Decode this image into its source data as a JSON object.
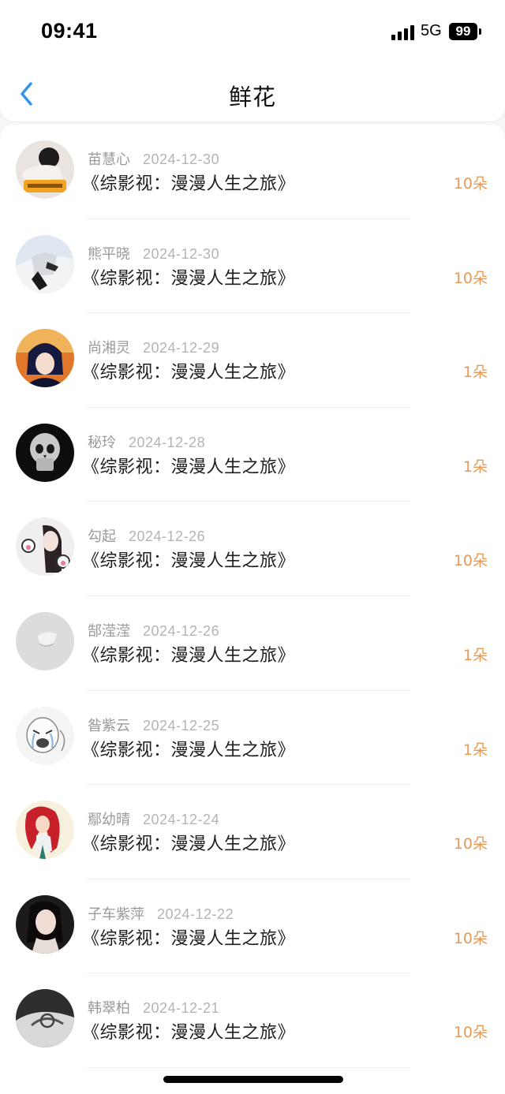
{
  "status_bar": {
    "time": "09:41",
    "network": "5G",
    "battery": "99"
  },
  "header": {
    "title": "鲜花",
    "back_icon": "chevron-left-icon"
  },
  "colors": {
    "accent": "#2f95e8",
    "flower_count": "#e79a55",
    "date_text": "#b4b4b4"
  },
  "items": [
    {
      "name": "苗慧心",
      "date": "2024-12-30",
      "work": "《综影视：漫漫人生之旅》",
      "flowers": "10朵"
    },
    {
      "name": "熊平晓",
      "date": "2024-12-30",
      "work": "《综影视：漫漫人生之旅》",
      "flowers": "10朵"
    },
    {
      "name": "尚湘灵",
      "date": "2024-12-29",
      "work": "《综影视：漫漫人生之旅》",
      "flowers": "1朵"
    },
    {
      "name": "秘玲",
      "date": "2024-12-28",
      "work": "《综影视：漫漫人生之旅》",
      "flowers": "1朵"
    },
    {
      "name": "勾起",
      "date": "2024-12-26",
      "work": "《综影视：漫漫人生之旅》",
      "flowers": "10朵"
    },
    {
      "name": "郜滢滢",
      "date": "2024-12-26",
      "work": "《综影视：漫漫人生之旅》",
      "flowers": "1朵"
    },
    {
      "name": "昝紫云",
      "date": "2024-12-25",
      "work": "《综影视：漫漫人生之旅》",
      "flowers": "1朵"
    },
    {
      "name": "鄢幼晴",
      "date": "2024-12-24",
      "work": "《综影视：漫漫人生之旅》",
      "flowers": "10朵"
    },
    {
      "name": "子车紫萍",
      "date": "2024-12-22",
      "work": "《综影视：漫漫人生之旅》",
      "flowers": "10朵"
    },
    {
      "name": "韩翠柏",
      "date": "2024-12-21",
      "work": "《综影视：漫漫人生之旅》",
      "flowers": "10朵"
    }
  ]
}
